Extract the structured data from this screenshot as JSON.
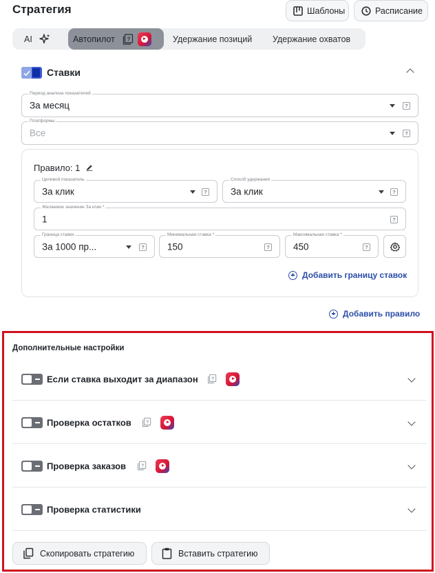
{
  "header": {
    "title": "Стратегия",
    "templates_label": "Шаблоны",
    "schedule_label": "Расписание"
  },
  "tabs": [
    {
      "label": "AI",
      "icon": "sparkle-icon"
    },
    {
      "label": "Автопилот",
      "active": true
    },
    {
      "label": "Удержание позиций"
    },
    {
      "label": "Удержание охватов"
    }
  ],
  "bids": {
    "label": "Ставки",
    "checked": true,
    "analysis_period": {
      "label": "Период анализа показателей",
      "value": "За месяц"
    },
    "platforms": {
      "label": "Платформы",
      "value": "Все"
    },
    "rule": {
      "title": "Правило: 1",
      "target_metric": {
        "label": "Целевой показатель",
        "value": "За клик"
      },
      "hold_method": {
        "label": "Способ удержания",
        "value": "За клик"
      },
      "desired_value": {
        "label": "Желаемое значение За клик *",
        "value": "1"
      },
      "bid_boundary": {
        "label": "Граница ставки",
        "value": "За 1000 пр..."
      },
      "min_bid": {
        "label": "Минимальная ставка *",
        "value": "150"
      },
      "max_bid": {
        "label": "Максимальная ставка *",
        "value": "450"
      },
      "add_boundary_label": "Добавить границу ставок"
    },
    "add_rule_label": "Добавить правило"
  },
  "advanced": {
    "title": "Дополнительные настройки",
    "items": [
      {
        "label": "Если ставка выходит за диапазон",
        "enabled": false
      },
      {
        "label": "Проверка остатков",
        "enabled": false
      },
      {
        "label": "Проверка заказов",
        "enabled": false
      },
      {
        "label": "Проверка статистики",
        "enabled": false
      }
    ],
    "copy_label": "Скопировать стратегию",
    "paste_label": "Вставить стратегию"
  },
  "colors": {
    "accent": "#2c4ea8",
    "highlight_border": "#d0111c",
    "checkbox": "#3a5bcd"
  }
}
